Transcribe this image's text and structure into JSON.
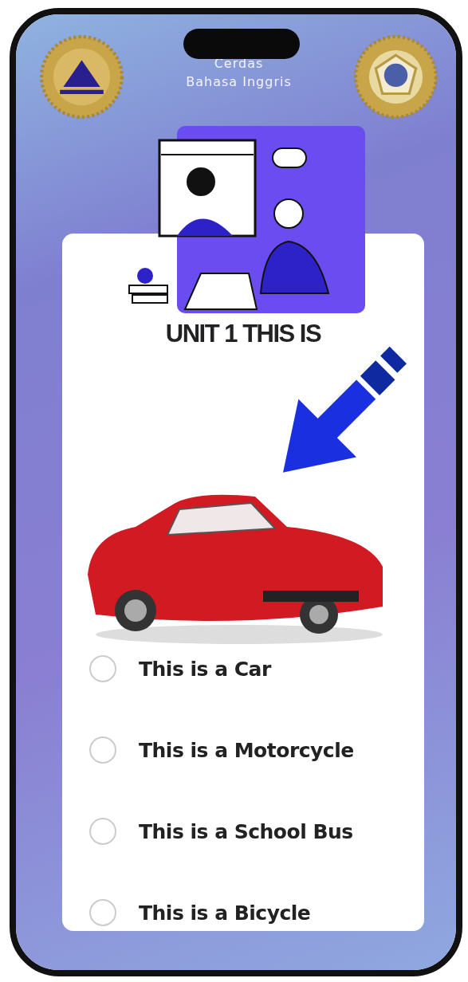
{
  "header": {
    "title_lines": [
      "Cerdas",
      "Bahasa Inggris"
    ]
  },
  "quiz": {
    "heading": "UNIT 1 THIS IS",
    "options": [
      {
        "label": "This is a Car",
        "selected": false
      },
      {
        "label": "This is a Motorcycle",
        "selected": false
      },
      {
        "label": "This is a School Bus",
        "selected": false
      },
      {
        "label": "This is a Bicycle",
        "selected": false
      }
    ]
  }
}
